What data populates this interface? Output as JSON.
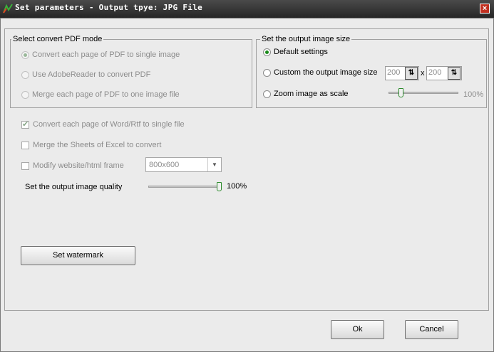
{
  "window": {
    "title": "Set parameters - Output tpye: JPG File",
    "close_glyph": "×"
  },
  "pdf_mode": {
    "title": "Select convert PDF mode",
    "options": [
      {
        "label": "Convert each page of PDF to single image",
        "selected": true
      },
      {
        "label": "Use AdobeReader to convert PDF",
        "selected": false
      },
      {
        "label": "Merge each page of PDF to one image file",
        "selected": false
      }
    ]
  },
  "image_size": {
    "title": "Set the output image size",
    "default_label": "Default settings",
    "custom_label": "Custom the output image size",
    "width_value": "200",
    "times": "x",
    "height_value": "200",
    "zoom_label": "Zoom image as scale",
    "zoom_percent": "100%",
    "zoom_level": 0.15
  },
  "options": {
    "word_label": "Convert each page of Word/Rtf to single file",
    "word_checked": true,
    "excel_label": "Merge the Sheets of Excel to convert",
    "website_label": "Modify website/html frame",
    "frame_size": "800x600",
    "quality_label": "Set the output image quality",
    "quality_percent": "100%",
    "quality_level": 1.0
  },
  "buttons": {
    "watermark": "Set watermark",
    "ok": "Ok",
    "cancel": "Cancel"
  }
}
